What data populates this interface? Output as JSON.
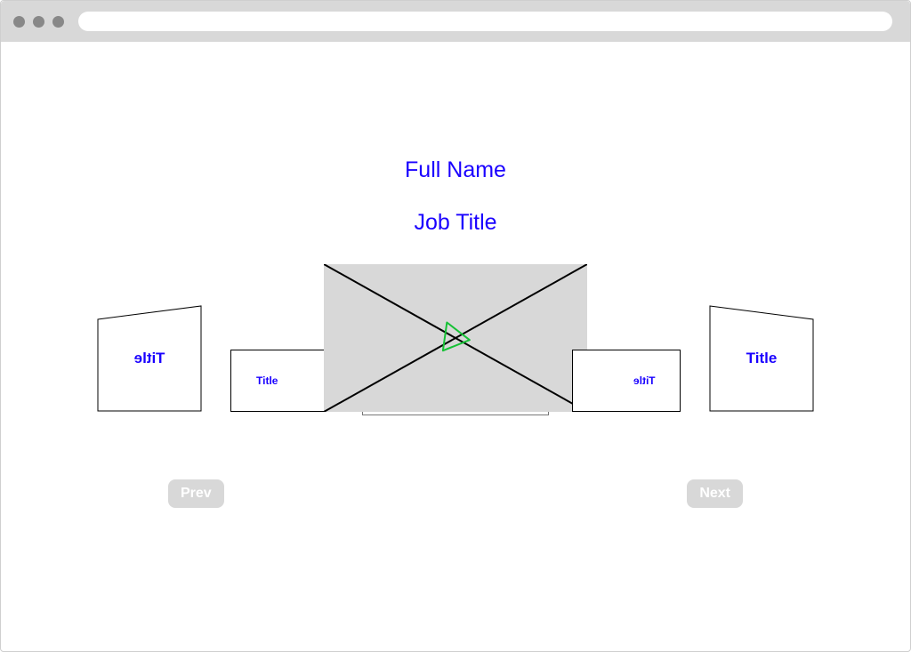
{
  "header": {
    "full_name": "Full Name",
    "job_title": "Job Title"
  },
  "carousel": {
    "outer_left_label": "Title",
    "mid_left_label": "Title",
    "mid_right_label": "Title",
    "outer_right_label": "Title"
  },
  "nav": {
    "prev_label": "Prev",
    "next_label": "Next"
  }
}
